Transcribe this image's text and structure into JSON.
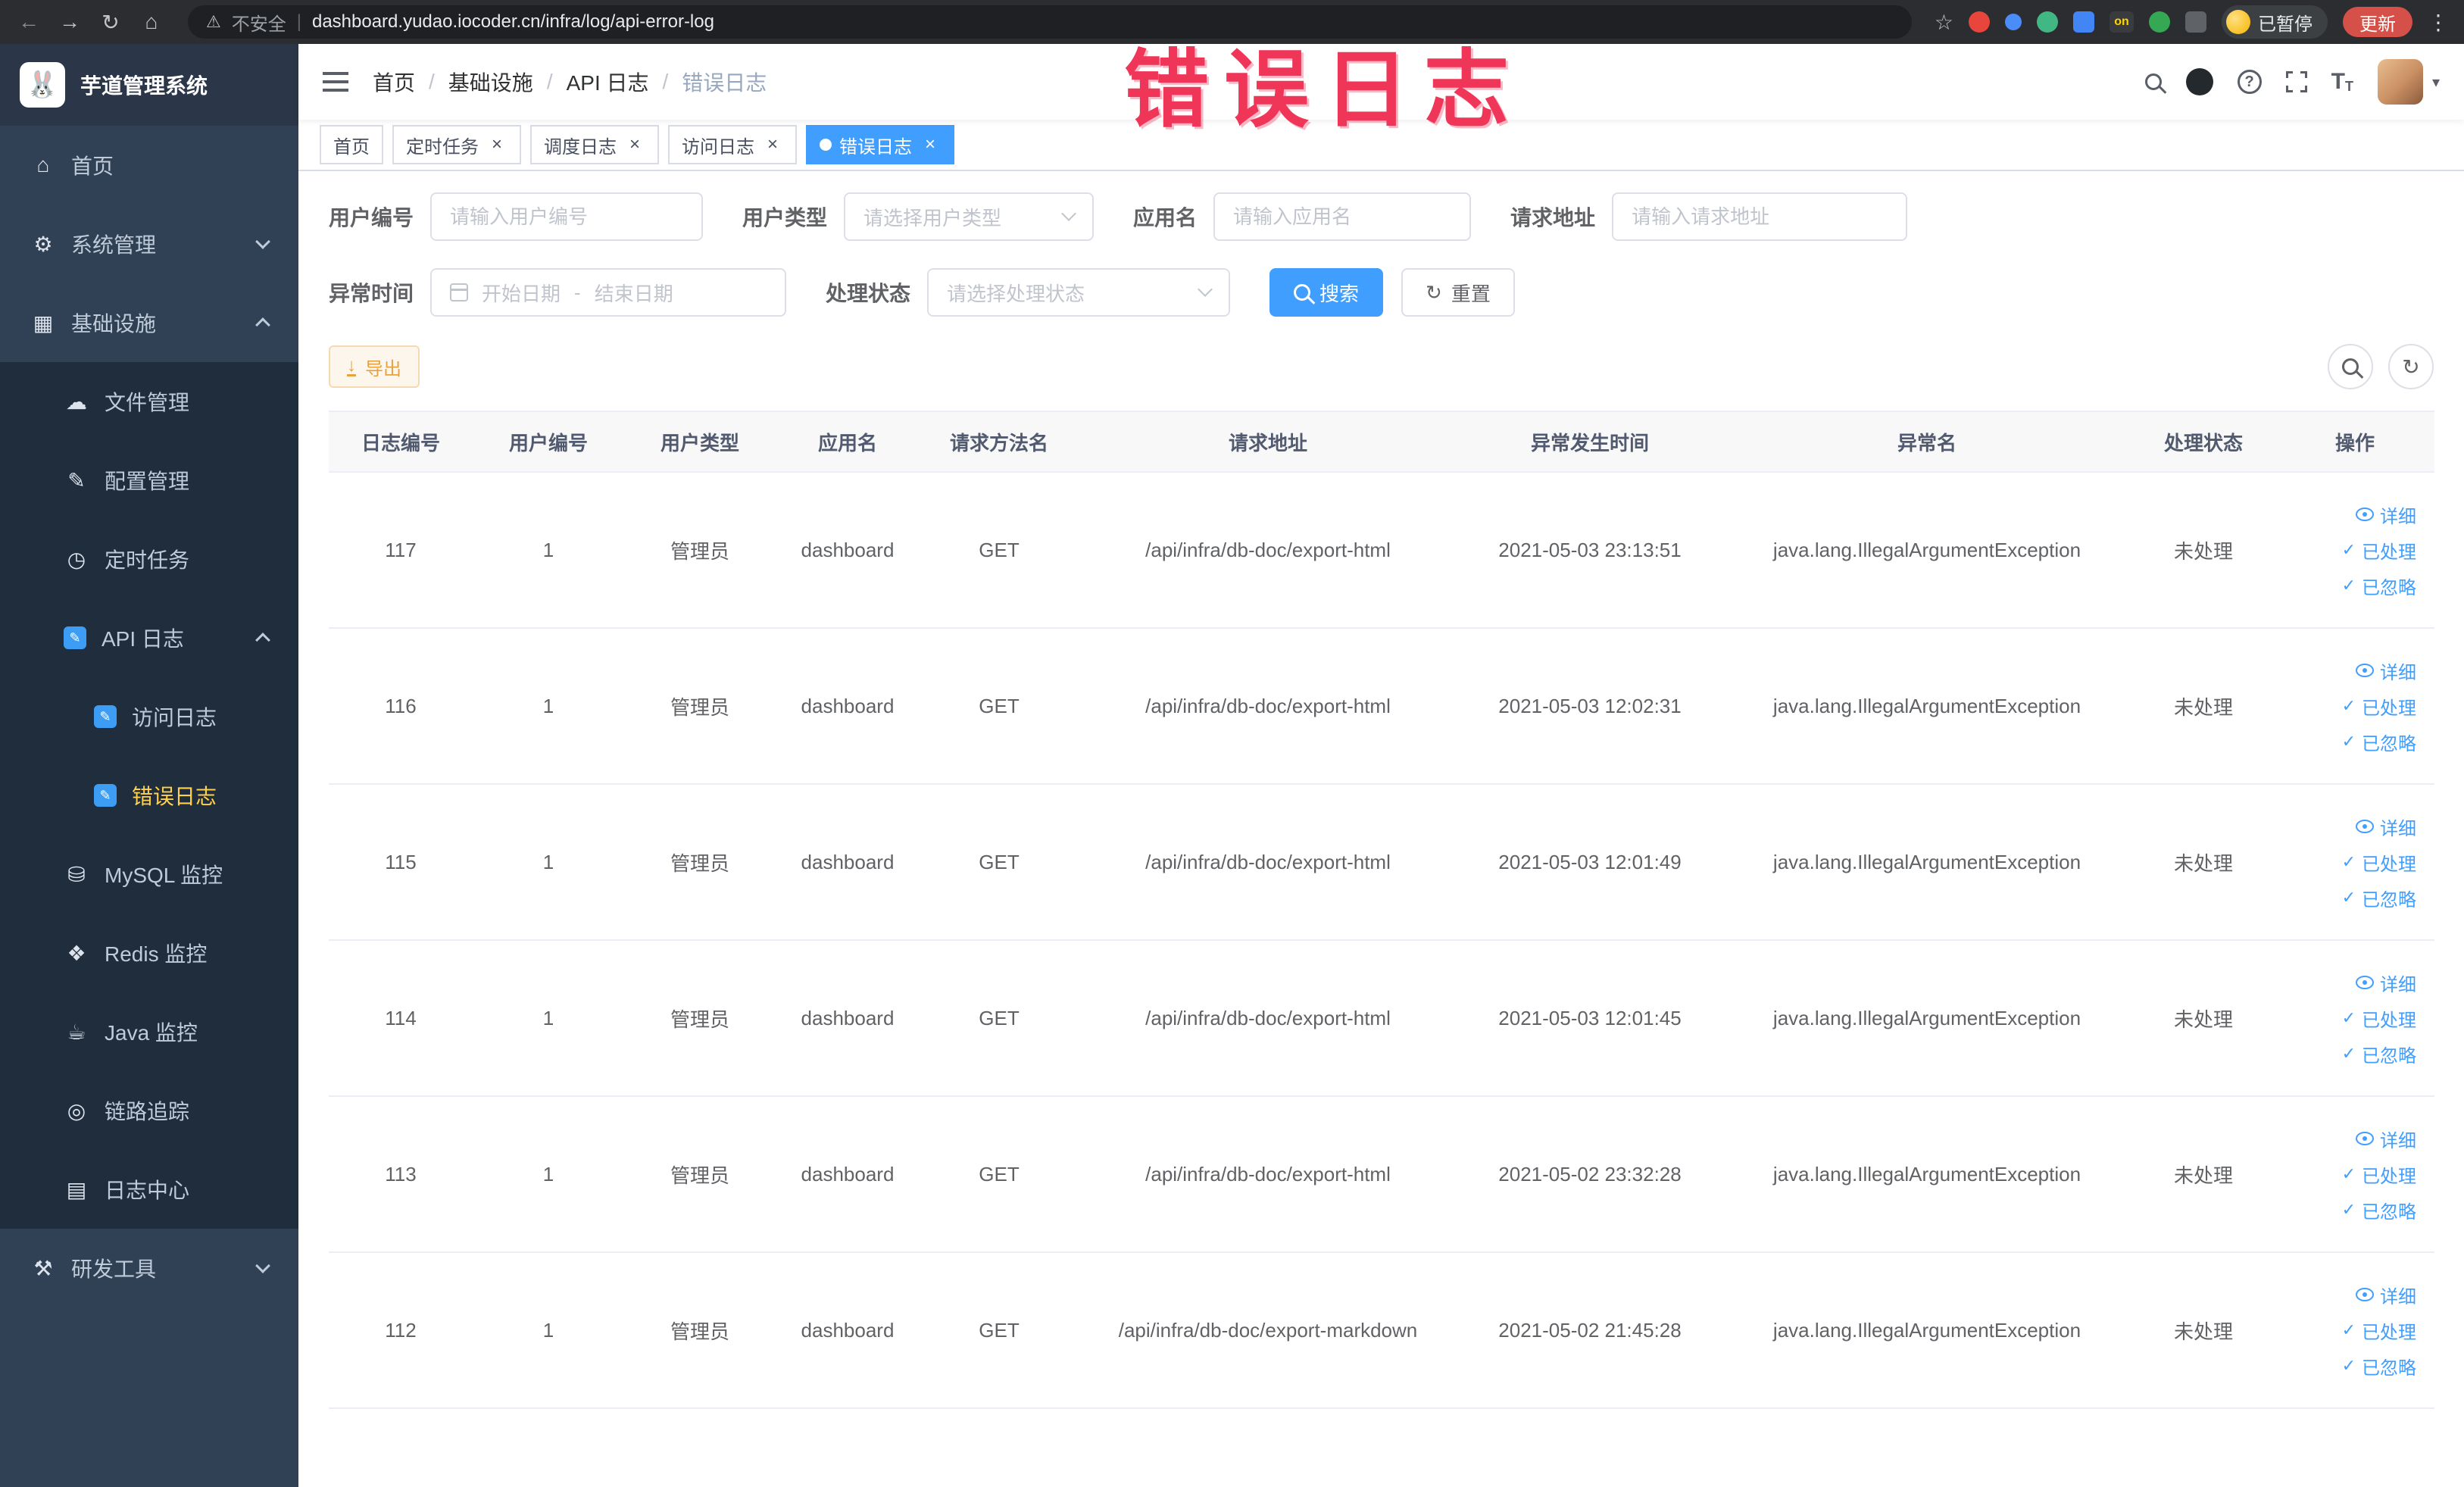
{
  "browser": {
    "security_label": "不安全",
    "url": "dashboard.yudao.iocoder.cn/infra/log/api-error-log",
    "profile_label": "已暂停",
    "update_label": "更新",
    "on_badge": "on"
  },
  "icons": {
    "back": "←",
    "forward": "→",
    "reload": "↻",
    "home": "⌂",
    "warning": "⚠",
    "star": "☆",
    "kebab": "⋮",
    "close": "×",
    "dash": "|",
    "gear": "⚙",
    "grid": "▦",
    "cloud": "☁",
    "pencil": "✎",
    "clock": "◷",
    "db": "⛁",
    "redis": "❖",
    "java": "☕",
    "trace": "◎",
    "logdoc": "▤",
    "tools": "⚒",
    "check": "✓",
    "download": "↓",
    "refresh": "↻",
    "caret": "▾",
    "question": "?",
    "tsize_big": "T",
    "tsize_small": "T",
    "bunny": "🐰",
    "separator": "/"
  },
  "annotation": "错误日志",
  "colors": {
    "accent": "#409eff",
    "sidebar_bg": "#304156",
    "submenu_bg": "#1f2d3d",
    "active_text": "#ffd04b",
    "warning": "#e6a23c",
    "annotation_red": "#ef3558"
  },
  "sidebar": {
    "logo_title": "芋道管理系统",
    "items": [
      {
        "label": "首页"
      },
      {
        "label": "系统管理"
      },
      {
        "label": "基础设施"
      },
      {
        "label": "文件管理"
      },
      {
        "label": "配置管理"
      },
      {
        "label": "定时任务"
      },
      {
        "label": "API 日志"
      },
      {
        "label": "访问日志"
      },
      {
        "label": "错误日志"
      },
      {
        "label": "MySQL 监控"
      },
      {
        "label": "Redis 监控"
      },
      {
        "label": "Java 监控"
      },
      {
        "label": "链路追踪"
      },
      {
        "label": "日志中心"
      },
      {
        "label": "研发工具"
      }
    ]
  },
  "topbar": {
    "breadcrumb": [
      "首页",
      "基础设施",
      "API 日志",
      "错误日志"
    ]
  },
  "tabs": [
    {
      "label": "首页"
    },
    {
      "label": "定时任务"
    },
    {
      "label": "调度日志"
    },
    {
      "label": "访问日志"
    },
    {
      "label": "错误日志"
    }
  ],
  "filters": {
    "user_id": {
      "label": "用户编号",
      "placeholder": "请输入用户编号"
    },
    "user_type": {
      "label": "用户类型",
      "placeholder": "请选择用户类型"
    },
    "app_name": {
      "label": "应用名",
      "placeholder": "请输入应用名"
    },
    "request_url": {
      "label": "请求地址",
      "placeholder": "请输入请求地址"
    },
    "exception_time": {
      "label": "异常时间",
      "start_placeholder": "开始日期",
      "separator": "-",
      "end_placeholder": "结束日期"
    },
    "process_status": {
      "label": "处理状态",
      "placeholder": "请选择处理状态"
    },
    "search_label": "搜索",
    "reset_label": "重置"
  },
  "toolbar": {
    "export_label": "导出"
  },
  "table": {
    "headers": [
      "日志编号",
      "用户编号",
      "用户类型",
      "应用名",
      "请求方法名",
      "请求地址",
      "异常发生时间",
      "异常名",
      "处理状态",
      "操作"
    ],
    "actions": {
      "detail": "详细",
      "processed": "已处理",
      "ignored": "已忽略"
    },
    "rows": [
      {
        "id": "117",
        "user_id": "1",
        "user_type": "管理员",
        "app": "dashboard",
        "method": "GET",
        "url": "/api/infra/db-doc/export-html",
        "time": "2021-05-03 23:13:51",
        "exception": "java.lang.IllegalArgumentException",
        "status": "未处理"
      },
      {
        "id": "116",
        "user_id": "1",
        "user_type": "管理员",
        "app": "dashboard",
        "method": "GET",
        "url": "/api/infra/db-doc/export-html",
        "time": "2021-05-03 12:02:31",
        "exception": "java.lang.IllegalArgumentException",
        "status": "未处理"
      },
      {
        "id": "115",
        "user_id": "1",
        "user_type": "管理员",
        "app": "dashboard",
        "method": "GET",
        "url": "/api/infra/db-doc/export-html",
        "time": "2021-05-03 12:01:49",
        "exception": "java.lang.IllegalArgumentException",
        "status": "未处理"
      },
      {
        "id": "114",
        "user_id": "1",
        "user_type": "管理员",
        "app": "dashboard",
        "method": "GET",
        "url": "/api/infra/db-doc/export-html",
        "time": "2021-05-03 12:01:45",
        "exception": "java.lang.IllegalArgumentException",
        "status": "未处理"
      },
      {
        "id": "113",
        "user_id": "1",
        "user_type": "管理员",
        "app": "dashboard",
        "method": "GET",
        "url": "/api/infra/db-doc/export-html",
        "time": "2021-05-02 23:32:28",
        "exception": "java.lang.IllegalArgumentException",
        "status": "未处理"
      },
      {
        "id": "112",
        "user_id": "1",
        "user_type": "管理员",
        "app": "dashboard",
        "method": "GET",
        "url": "/api/infra/db-doc/export-markdown",
        "time": "2021-05-02 21:45:28",
        "exception": "java.lang.IllegalArgumentException",
        "status": "未处理"
      }
    ]
  }
}
